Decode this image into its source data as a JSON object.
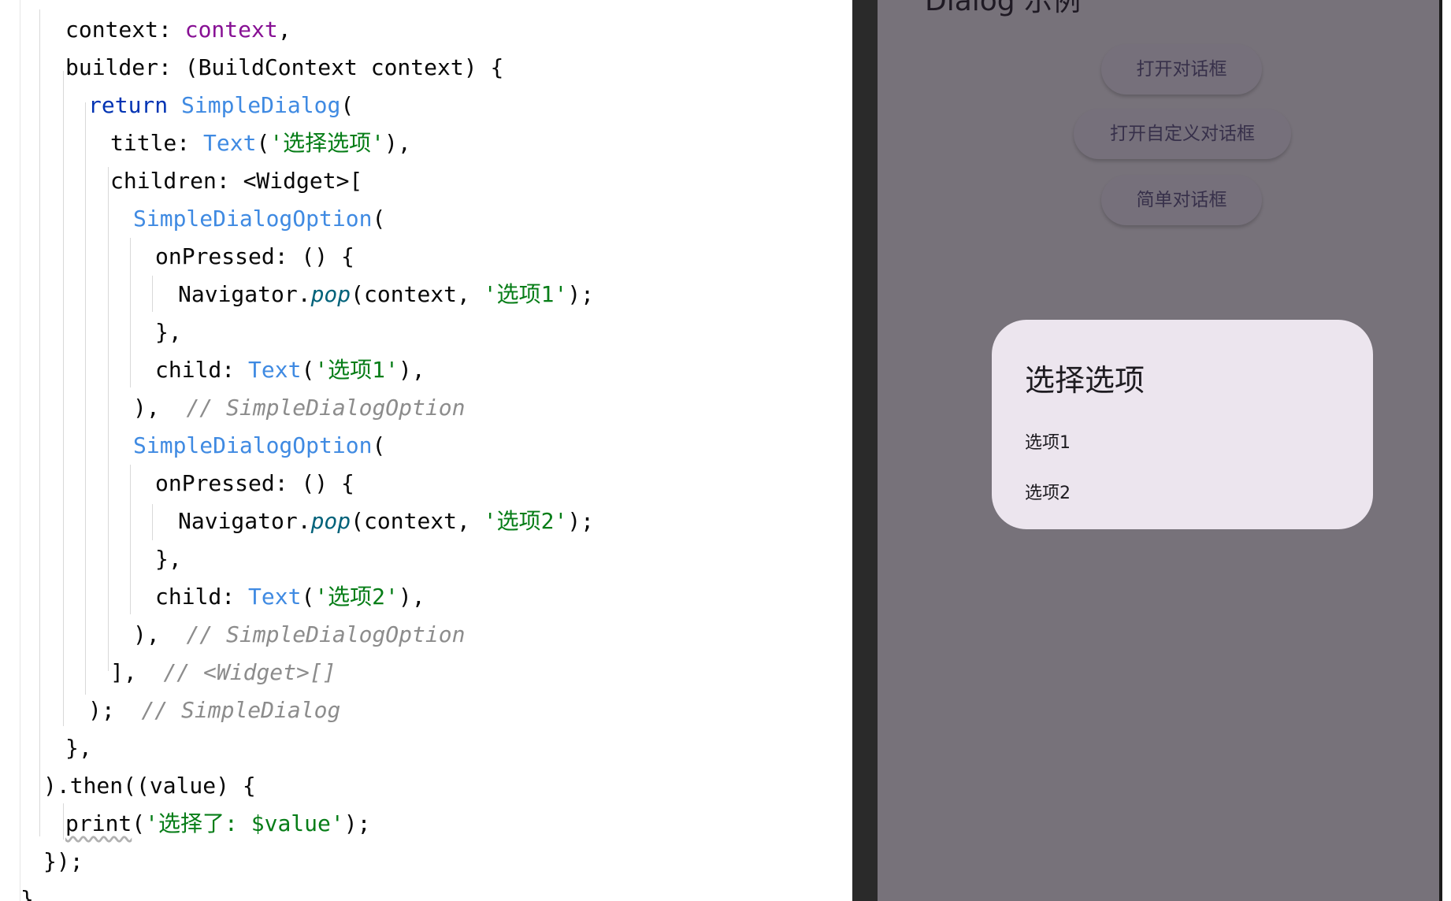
{
  "code": {
    "line1": {
      "a": "context: ",
      "b": "context",
      "c": ","
    },
    "line2": {
      "a": "builder: (BuildContext context) {"
    },
    "line3": {
      "kw": "return",
      "sp": " ",
      "cls": "SimpleDialog",
      "rest": "("
    },
    "line4": {
      "a": "title: ",
      "cls": "Text",
      "b": "(",
      "str": "'选择选项'",
      "c": "),"
    },
    "line5": {
      "a": "children: <Widget>["
    },
    "line6": {
      "cls": "SimpleDialogOption",
      "rest": "("
    },
    "line7": {
      "a": "onPressed: () {"
    },
    "line8": {
      "a": "Navigator.",
      "method": "pop",
      "b": "(context, ",
      "str": "'选项1'",
      "c": ");"
    },
    "line9": {
      "a": "},"
    },
    "line10": {
      "a": "child: ",
      "cls": "Text",
      "b": "(",
      "str": "'选项1'",
      "c": "),"
    },
    "line11": {
      "a": "),  ",
      "comment": "// SimpleDialogOption"
    },
    "line12": {
      "cls": "SimpleDialogOption",
      "rest": "("
    },
    "line13": {
      "a": "onPressed: () {"
    },
    "line14": {
      "a": "Navigator.",
      "method": "pop",
      "b": "(context, ",
      "str": "'选项2'",
      "c": ");"
    },
    "line15": {
      "a": "},"
    },
    "line16": {
      "a": "child: ",
      "cls": "Text",
      "b": "(",
      "str": "'选项2'",
      "c": "),"
    },
    "line17": {
      "a": "),  ",
      "comment": "// SimpleDialogOption"
    },
    "line18": {
      "a": "],  ",
      "comment": "// <Widget>[]"
    },
    "line19": {
      "a": ");  ",
      "comment": "// SimpleDialog"
    },
    "line20": {
      "a": "},"
    },
    "line21": {
      "a": ").then((value) {"
    },
    "line22": {
      "fn": "print",
      "b": "(",
      "str": "'选择了: $value'",
      "c": ");"
    },
    "line23": {
      "a": "});"
    },
    "line24": {
      "a": "}"
    }
  },
  "app": {
    "title": "Dialog 示例",
    "buttons": {
      "open_dialog": "打开对话框",
      "open_custom_dialog": "打开自定义对话框",
      "simple_dialog": "简单对话框"
    },
    "dialog": {
      "title": "选择选项",
      "options": [
        "选项1",
        "选项2"
      ]
    }
  },
  "colors": {
    "keyword": "#0033b3",
    "class": "#3f8ae2",
    "string": "#067d17",
    "field": "#871094",
    "method": "#00627a",
    "comment": "#8c8c8c",
    "scrim": "#77727a",
    "dialog_surface": "#ece5ee"
  }
}
